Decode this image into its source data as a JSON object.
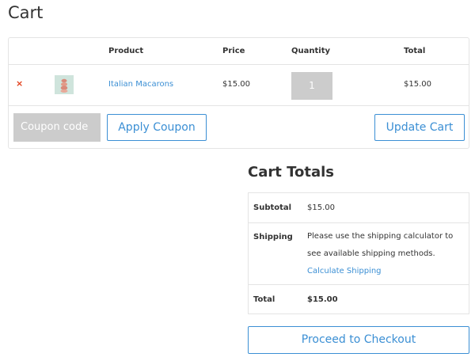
{
  "page": {
    "title": "Cart"
  },
  "cart": {
    "headers": {
      "product": "Product",
      "price": "Price",
      "quantity": "Quantity",
      "total": "Total"
    },
    "items": [
      {
        "remove_symbol": "×",
        "product": "Italian Macarons",
        "price": "$15.00",
        "quantity": "1",
        "total": "$15.00",
        "thumbnail_icon": "macaron-stack-icon"
      }
    ],
    "coupon_placeholder": "Coupon code",
    "apply_coupon_label": "Apply Coupon",
    "update_cart_label": "Update Cart"
  },
  "totals": {
    "title": "Cart Totals",
    "subtotal_label": "Subtotal",
    "subtotal_value": "$15.00",
    "shipping_label": "Shipping",
    "shipping_text": "Please use the shipping calculator to see available shipping methods.",
    "shipping_link": "Calculate Shipping",
    "total_label": "Total",
    "total_value": "$15.00"
  },
  "checkout_label": "Proceed to Checkout",
  "colors": {
    "accent": "#3b8fd4",
    "remove": "#e2401c",
    "disabled_gray": "#cccccc",
    "border": "#e4e4e4"
  }
}
